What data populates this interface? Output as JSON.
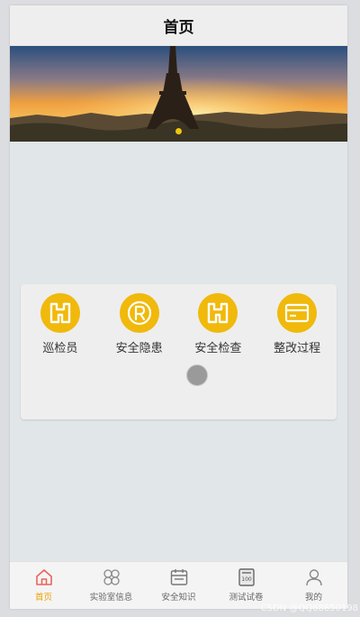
{
  "header": {
    "title": "首页"
  },
  "banner": {
    "image": "eiffel-tower-sunset",
    "slide_count": 1,
    "active_index": 0
  },
  "grid": [
    {
      "label": "巡检员",
      "icon": "binoculars-icon"
    },
    {
      "label": "安全隐患",
      "icon": "registered-icon"
    },
    {
      "label": "安全检查",
      "icon": "binoculars-icon"
    },
    {
      "label": "整改过程",
      "icon": "card-icon"
    }
  ],
  "tabbar": [
    {
      "label": "首页",
      "icon": "home-icon",
      "active": true
    },
    {
      "label": "实验室信息",
      "icon": "lab-icon",
      "active": false
    },
    {
      "label": "安全知识",
      "icon": "calendar-icon",
      "active": false
    },
    {
      "label": "测试试卷",
      "icon": "exam-icon",
      "active": false
    },
    {
      "label": "我的",
      "icon": "user-icon",
      "active": false
    }
  ],
  "watermark": "CSDN @QQ68850198",
  "colors": {
    "accent": "#f0b90b",
    "active_tab": "#f0a000",
    "home_icon": "#e8645a",
    "page_bg": "#e1e6e9"
  }
}
